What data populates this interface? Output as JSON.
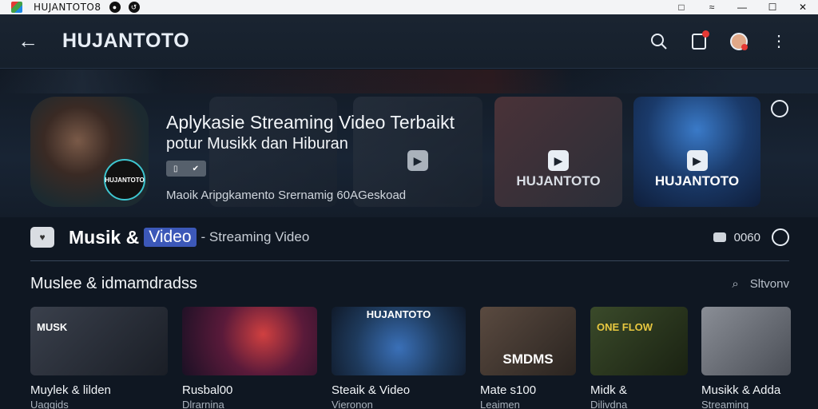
{
  "window": {
    "title": "HUJANTOTO8",
    "controls": [
      "□",
      "—",
      "☐",
      "✕"
    ]
  },
  "header": {
    "back_icon": "←",
    "brand": "HUJANTOTO",
    "search_icon": "⌕",
    "more_icon": "⋮"
  },
  "hero": {
    "badge": "HUJANTOTO",
    "title": "Aplykasie Streaming Video Terbaikt",
    "subtitle": "potur Musikk dan Hiburan",
    "chip_a": "▯",
    "chip_b": "✔",
    "description": "Maoik Aripgkamento Srernamig 60AGeskoad",
    "cards": [
      {
        "label": ""
      },
      {
        "label": ""
      },
      {
        "label": "HUJANTOTO"
      },
      {
        "label": "HUJANTOTO"
      }
    ]
  },
  "section": {
    "icon": "♥",
    "title": "Musik &",
    "pill": "Video",
    "subtitle": "- Streaming Video",
    "count": "0060"
  },
  "grid": {
    "title": "Muslee & idmamdradss",
    "search_icon": "⌕",
    "search_label": "Sltvonv",
    "items": [
      {
        "overlay": "MUSK",
        "caption": "Muylek & lilden",
        "sub": "Uagqids",
        "bg": "#2a2f3a"
      },
      {
        "overlay": "",
        "caption": "Rusbal00",
        "sub": "Dlrarnina",
        "bg": "#3a1e2c"
      },
      {
        "overlay": "HUJANTOTO",
        "caption": "Steaik & Video",
        "sub": "Vieronon",
        "bg": "#1e3a5c"
      },
      {
        "overlay": "SMDMS",
        "caption": "Mate s100",
        "sub": "Leaimen",
        "bg": "#3a302a"
      },
      {
        "overlay": "ONE FLOW",
        "caption": "Midk &",
        "sub": "Dilivdna",
        "bg": "#2a3522"
      },
      {
        "overlay": "",
        "caption": "Musikk & Adda",
        "sub": "Streaming",
        "bg": "#4a4e56"
      }
    ]
  }
}
